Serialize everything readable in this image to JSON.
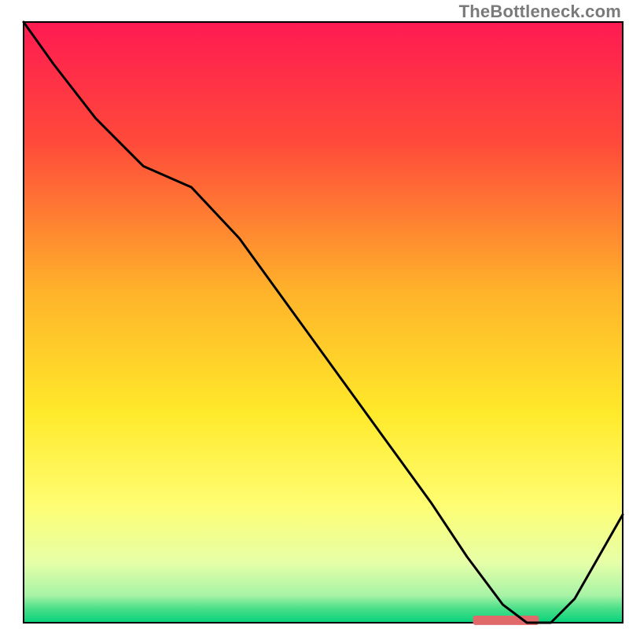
{
  "watermark": "TheBottleneck.com",
  "chart_data": {
    "type": "line",
    "title": "",
    "xlabel": "",
    "ylabel": "",
    "xlim": [
      0,
      100
    ],
    "ylim": [
      0,
      100
    ],
    "axes_visible": false,
    "grid": false,
    "background": {
      "type": "vertical-gradient",
      "stops": [
        {
          "pos": 0.0,
          "color": "#ff1a52"
        },
        {
          "pos": 0.2,
          "color": "#ff4a3a"
        },
        {
          "pos": 0.45,
          "color": "#ffb32a"
        },
        {
          "pos": 0.65,
          "color": "#ffe92a"
        },
        {
          "pos": 0.8,
          "color": "#fffd70"
        },
        {
          "pos": 0.9,
          "color": "#e6ffa8"
        },
        {
          "pos": 0.955,
          "color": "#a6f3a6"
        },
        {
          "pos": 0.975,
          "color": "#4fe08a"
        },
        {
          "pos": 1.0,
          "color": "#05d27b"
        }
      ]
    },
    "series": [
      {
        "name": "bottleneck-curve",
        "color": "#000000",
        "x": [
          0,
          5,
          12,
          20,
          28,
          36,
          44,
          52,
          60,
          68,
          74,
          80,
          84,
          88,
          92,
          96,
          100
        ],
        "y": [
          100,
          93,
          84,
          76,
          72.5,
          64,
          53,
          42,
          31,
          20,
          11,
          3,
          0,
          0,
          4,
          11,
          18
        ]
      }
    ],
    "optimum_marker": {
      "name": "optimum-range",
      "color": "#e06a6a",
      "x_start": 75,
      "x_end": 86,
      "y": 0.4,
      "thickness_pct": 0.9
    }
  }
}
